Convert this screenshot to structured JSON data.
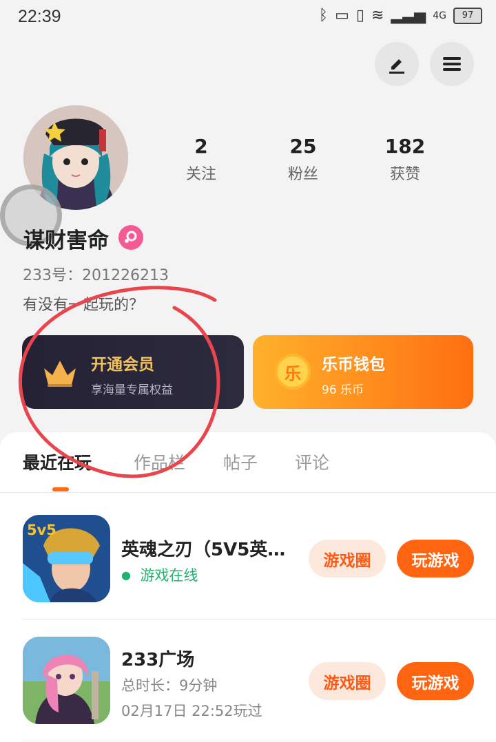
{
  "status_bar": {
    "time": "22:39",
    "network": "4G",
    "battery": "97"
  },
  "header": {
    "edit_icon": "edit-icon",
    "menu_icon": "menu-icon"
  },
  "profile": {
    "nickname": "谋财害命",
    "gender_icon": "female-icon",
    "id_text": "233号：201226213",
    "bio": "有没有一起玩的？",
    "stats": [
      {
        "value": "2",
        "label": "关注"
      },
      {
        "value": "25",
        "label": "粉丝"
      },
      {
        "value": "182",
        "label": "获赞"
      }
    ]
  },
  "cards": {
    "vip": {
      "title": "开通会员",
      "subtitle": "享海量专属权益",
      "icon": "crown-icon"
    },
    "wallet": {
      "icon_text": "乐",
      "title": "乐币钱包",
      "subtitle": "96 乐币"
    }
  },
  "tabs": [
    "最近在玩",
    "作品栏",
    "帖子",
    "评论"
  ],
  "games": [
    {
      "name": "英魂之刃（5V5英…",
      "meta1": "游戏在线",
      "circle": "游戏圈",
      "play": "玩游戏"
    },
    {
      "name": "233广场",
      "meta1": "总时长：9分钟",
      "meta2": "02月17日 22:52玩过",
      "circle": "游戏圈",
      "play": "玩游戏"
    }
  ],
  "colors": {
    "accent": "#ff6410",
    "vip_text": "#f4c25d",
    "online": "#1db56c",
    "annotation": "#e8454d"
  }
}
